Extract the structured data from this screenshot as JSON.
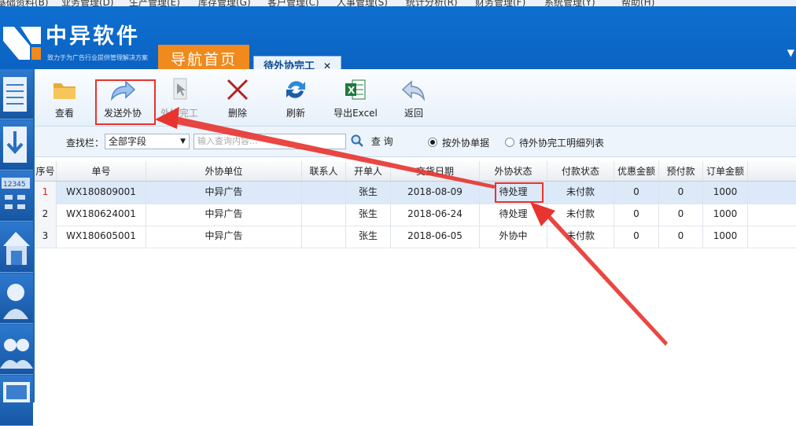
{
  "menu": [
    "基础资料(B)",
    "业务管理(D)",
    "生产管理(E)",
    "库存管理(G)",
    "客户管理(C)",
    "人事管理(S)",
    "统计分析(R)",
    "财务管理(F)",
    "系统管理(Y)",
    "帮助(H)"
  ],
  "brand": {
    "name": "中异软件",
    "slogan": "致力于为广告行业提供管理解决方案"
  },
  "tabs": {
    "home": "导航首页",
    "active": "待外协完工",
    "close": "✕"
  },
  "toolbar": {
    "view": "查看",
    "send": "发送外协",
    "complete": "外协完工",
    "delete": "删除",
    "refresh": "刷新",
    "export": "导出Excel",
    "back": "返回"
  },
  "search": {
    "label": "查找栏：",
    "field": "全部字段",
    "placeholder": "输入查询内容...",
    "query": "查 询",
    "radio1": "按外协单据",
    "radio2": "待外协完工明细列表"
  },
  "table": {
    "headers": [
      "序号",
      "单号",
      "外协单位",
      "联系人",
      "开单人",
      "交货日期",
      "外协状态",
      "付款状态",
      "优惠金额",
      "预付款",
      "订单金额"
    ],
    "rows": [
      [
        "1",
        "WX180809001",
        "中异广告",
        "",
        "张生",
        "2018-08-09",
        "待处理",
        "未付款",
        "0",
        "0",
        "1000"
      ],
      [
        "2",
        "WX180624001",
        "中异广告",
        "",
        "张生",
        "2018-06-24",
        "待处理",
        "未付款",
        "0",
        "0",
        "1000"
      ],
      [
        "3",
        "WX180605001",
        "中异广告",
        "",
        "张生",
        "2018-06-05",
        "外协中",
        "未付款",
        "0",
        "0",
        "1000"
      ]
    ]
  },
  "colors": {
    "header": "#0b63c2",
    "homeTab": "#f08a1c",
    "highlight": "#e8332e"
  },
  "icons": [
    "folder-icon",
    "share-arrow-icon",
    "cursor-icon",
    "delete-x-icon",
    "refresh-icon",
    "excel-icon",
    "back-arrow-icon",
    "search-icon"
  ]
}
